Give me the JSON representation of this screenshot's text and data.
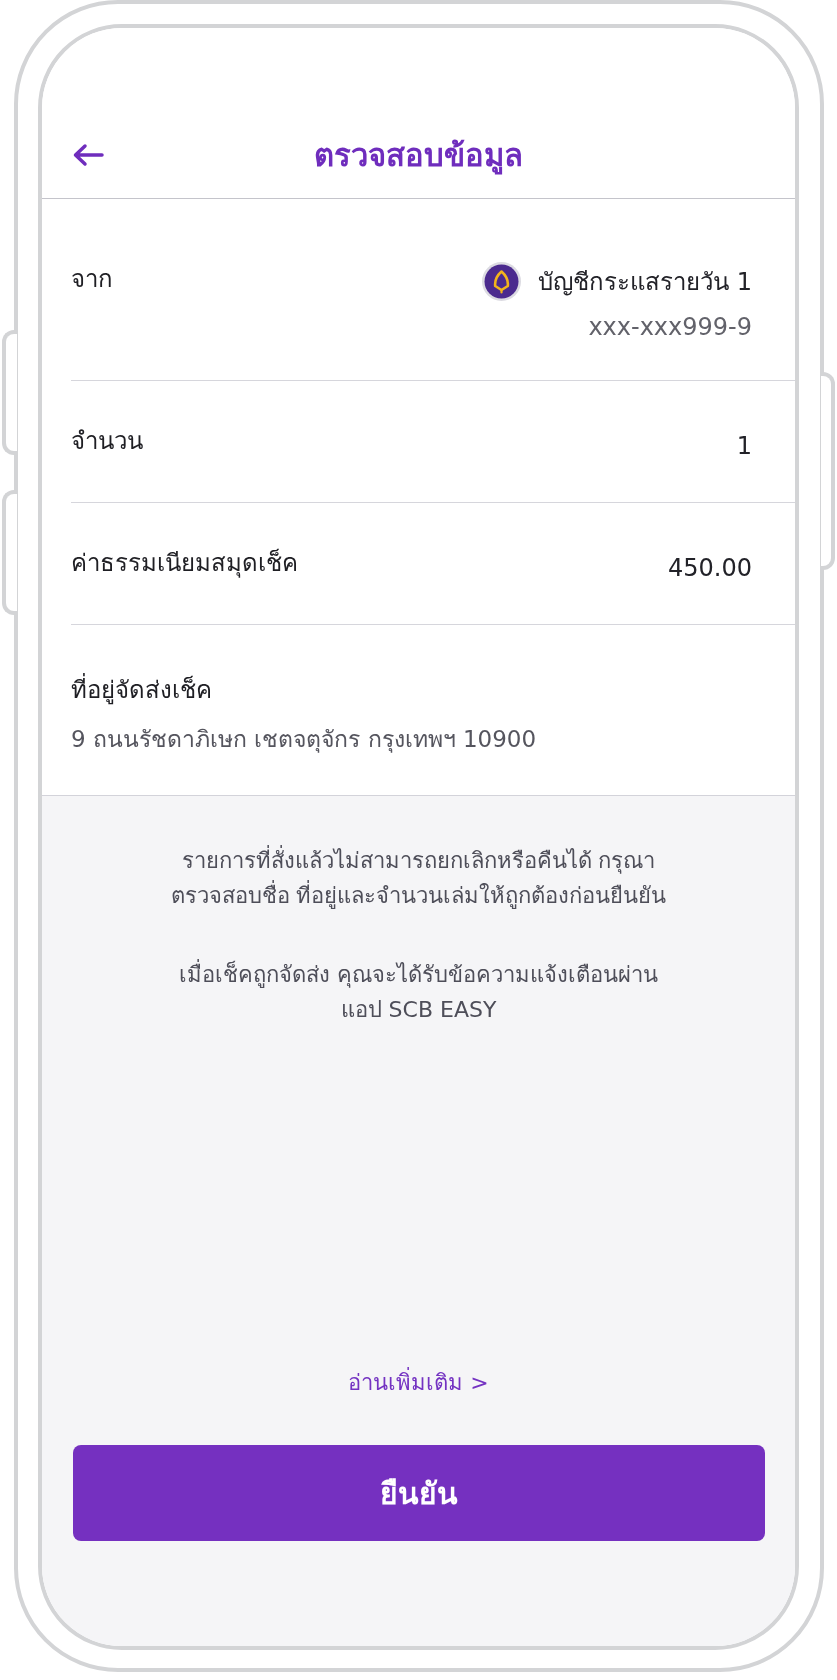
{
  "header": {
    "title": "ตรวจสอบข้อมูล"
  },
  "details": [
    {
      "kind": "account",
      "label": "จาก",
      "account_name": "บัญชีกระแสรายวัน 1",
      "account_number": "xxx-xxx999-9"
    },
    {
      "kind": "value",
      "label": "จำนวน",
      "value": "1"
    },
    {
      "kind": "value",
      "label": "ค่าธรรมเนียมสมุดเช็ค",
      "value": "450.00"
    },
    {
      "kind": "stacked",
      "label": "ที่อยู่จัดส่งเช็ค",
      "value": "9 ถนนรัชดาภิเษก เชตจตุจักร กรุงเทพฯ 10900"
    }
  ],
  "notes": [
    {
      "lines": [
        "รายการที่สั่งแล้วไม่สามารถยกเลิกหรือคืนได้ กรุณา",
        "ตรวจสอบชื่อ ที่อยู่และจำนวนเล่มให้ถูกต้องก่อนยืนยัน"
      ]
    },
    {
      "lines": [
        "เมื่อเช็คถูกจัดส่ง คุณจะได้รับข้อความแจ้งเตือนผ่าน",
        "แอป SCB EASY"
      ]
    }
  ],
  "read_more_link": "อ่านเพิ่มเติม >",
  "confirm_button": "ยืนยัน"
}
